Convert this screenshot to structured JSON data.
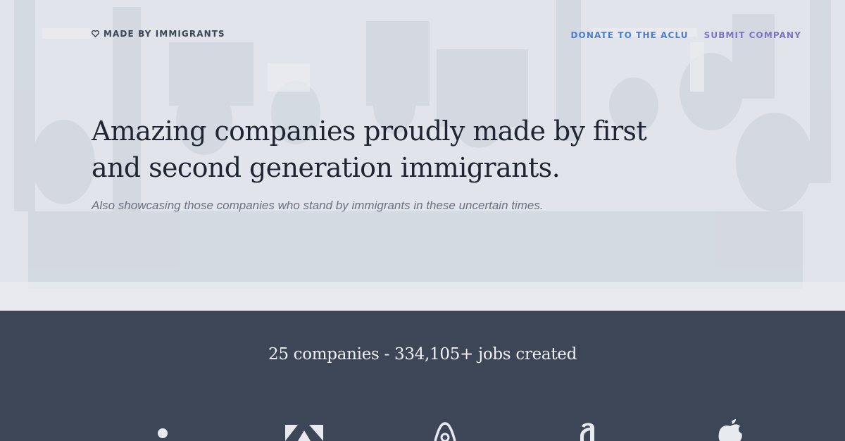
{
  "header": {
    "brand_label": "MADE BY IMMIGRANTS",
    "nav": {
      "donate_label": "DONATE TO THE ACLU",
      "submit_label": "SUBMIT COMPANY"
    }
  },
  "hero": {
    "headline": "Amazing companies proudly made by first and second generation immigrants.",
    "subline": "Also showcasing those companies who stand by immigrants in these uncertain times."
  },
  "stats": {
    "summary": "25 companies - 334,105+ jobs created"
  },
  "logos": {
    "items": [
      "instagram-logo-icon",
      "adobe-logo-icon",
      "airbnb-logo-icon",
      "amazon-logo-icon",
      "apple-logo-icon"
    ]
  },
  "colors": {
    "hero_background": "#e1e4ea",
    "dark_section": "#3c4657",
    "donate_link": "#4a7fd4",
    "submit_link": "#7d73c9",
    "headline_text": "#1f2533"
  }
}
